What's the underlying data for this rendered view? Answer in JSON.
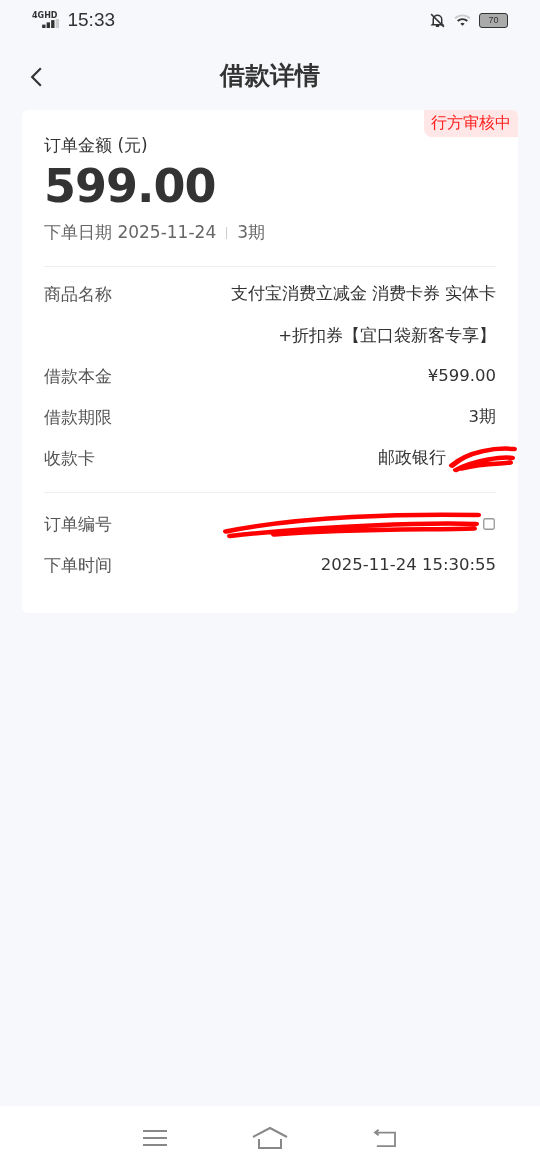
{
  "status_bar": {
    "network": "4GHD",
    "time": "15:33",
    "battery": "70"
  },
  "header": {
    "title": "借款详情"
  },
  "order": {
    "badge": "行方审核中",
    "amount_label": "订单金额 (元)",
    "amount": "599.00",
    "date": "下单日期 2025-11-24",
    "term": "3期"
  },
  "details": [
    {
      "label": "商品名称",
      "value": "支付宝消费立减金 消费卡券 实体卡+折扣券【宜口袋新客专享】",
      "redacted": false
    },
    {
      "label": "借款本金",
      "value": "¥599.00",
      "redacted": false
    },
    {
      "label": "借款期限",
      "value": "3期",
      "redacted": false
    },
    {
      "label": "收款卡",
      "value": "邮政银行",
      "redacted": true
    }
  ],
  "order_info": [
    {
      "label": "订单编号",
      "redacted": true,
      "copyable": true
    },
    {
      "label": "下单时间",
      "value": "2025-11-24 15:30:55",
      "redacted": false,
      "copyable": false
    }
  ]
}
